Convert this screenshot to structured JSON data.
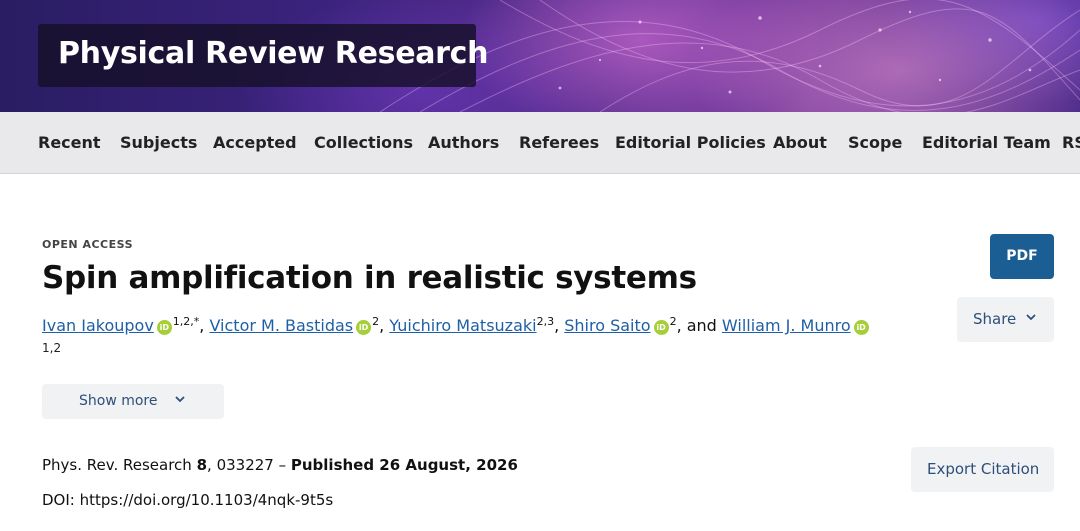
{
  "journal": {
    "title": "Physical Review Research"
  },
  "nav": {
    "items": [
      {
        "label": "Recent"
      },
      {
        "label": "Subjects"
      },
      {
        "label": "Accepted"
      },
      {
        "label": "Collections"
      },
      {
        "label": "Authors"
      },
      {
        "label": "Referees"
      },
      {
        "label": "Editorial Policies"
      },
      {
        "label": "About"
      },
      {
        "label": "Scope"
      },
      {
        "label": "Editorial Team"
      },
      {
        "label": "RSS"
      }
    ]
  },
  "article": {
    "badge": "OPEN ACCESS",
    "title": "Spin amplification in realistic systems",
    "authors": [
      {
        "name": "Ivan Iakoupov",
        "sup": "1,2,*"
      },
      {
        "name": "Victor M. Bastidas",
        "sup": "2"
      },
      {
        "name": "Yuichiro Matsuzaki",
        "sup": "2,3"
      },
      {
        "name": "Shiro Saito",
        "sup": "2"
      },
      {
        "name": "William J. Munro",
        "sup": "1,2"
      }
    ],
    "separator": ", ",
    "conjunction": ", and ",
    "orcid_icon": "iD",
    "show_more_label": "Show more",
    "citation": {
      "journal": "Phys. Rev. Research",
      "volume": "8",
      "article_number": ", 033227 – ",
      "published": "Published 26 August, 2026"
    },
    "doi": "DOI: https://doi.org/10.1103/4nqk-9t5s"
  },
  "actions": {
    "pdf_label": "PDF",
    "share_label": "Share",
    "export_label": "Export Citation"
  },
  "colors": {
    "link": "#1f5fa6",
    "pdf_button": "#1b5e94",
    "orcid": "#a6ce39"
  }
}
